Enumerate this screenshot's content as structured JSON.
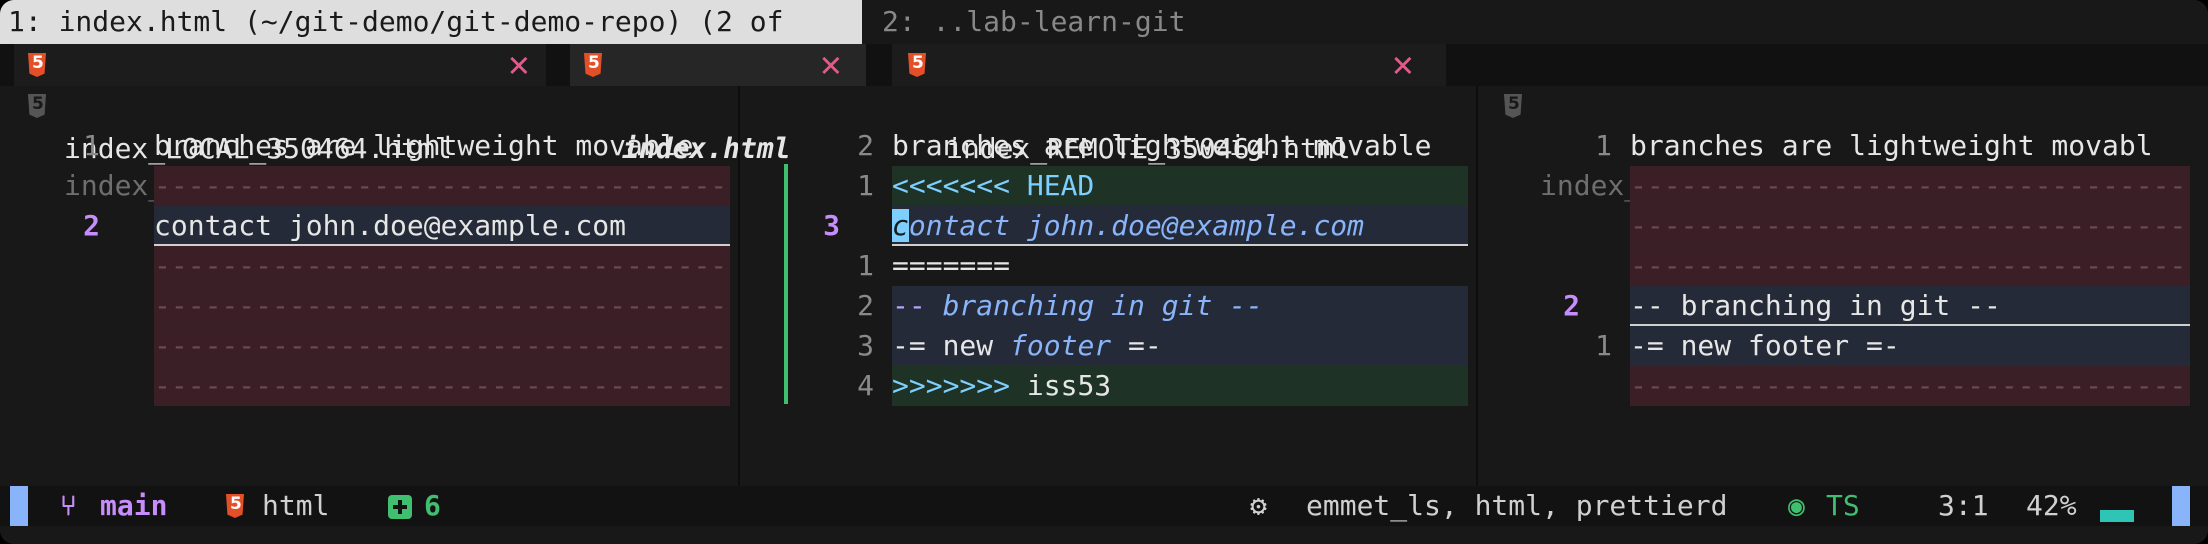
{
  "tmux": {
    "window1": "1: index.html (~/git-demo/git-demo-repo) (2 of",
    "window2": "2: ..lab-learn-git"
  },
  "tabs": [
    {
      "label": "index_LOCAL_350464.html",
      "close": "✕",
      "active": false
    },
    {
      "label": "index.html",
      "close": "✕",
      "active": true
    },
    {
      "label": "index_REMOTE_350464.html",
      "close": "✕",
      "active": false
    }
  ],
  "panes": {
    "local": {
      "winbar": "index_LOCAL_350464.html",
      "lines": [
        {
          "num": "1",
          "text": "branches are lightweight movable"
        },
        {
          "num": "",
          "text": "--------------------------------------"
        },
        {
          "num": "2",
          "text": "contact john.doe@example.com"
        },
        {
          "num": "",
          "text": "--------------------------------------"
        },
        {
          "num": "",
          "text": "--------------------------------------"
        },
        {
          "num": "",
          "text": "--------------------------------------"
        },
        {
          "num": "",
          "text": "--------------------------------------"
        }
      ]
    },
    "merged": {
      "lines": [
        {
          "num": "2",
          "text": "branches are lightweight movable"
        },
        {
          "num": "1",
          "text": "<<<<<<< HEAD"
        },
        {
          "num": "3",
          "cursor_char": "c",
          "text": "ontact john.doe@example.com"
        },
        {
          "num": "1",
          "text": "======="
        },
        {
          "num": "2",
          "prefix": "-- ",
          "text": "branching in git --"
        },
        {
          "num": "3",
          "prefix": "-= new ",
          "text": "footer",
          "suffix": " =-"
        },
        {
          "num": "4",
          "prefix": ">>>>>>>",
          "text": " iss53"
        }
      ]
    },
    "remote": {
      "winbar": "index_REMOTE_350464.html",
      "lines": [
        {
          "num": "1",
          "text": "branches are lightweight movabl"
        },
        {
          "num": "",
          "text": "--------------------------------------"
        },
        {
          "num": "",
          "text": "--------------------------------------"
        },
        {
          "num": "",
          "text": "--------------------------------------"
        },
        {
          "num": "2",
          "text": "-- branching in git --"
        },
        {
          "num": "1",
          "text": "-= new footer =-"
        },
        {
          "num": "",
          "text": "--------------------------------------"
        }
      ]
    }
  },
  "statusline": {
    "branch": "main",
    "filetype": "html",
    "added": "6",
    "lsp": "emmet_ls, html, prettierd",
    "treesitter": "TS",
    "position": "3:1",
    "percent": "42%"
  },
  "colors": {
    "accent": "#89b4fa",
    "added": "#3fbf6f",
    "branch": "#c68dfb",
    "close": "#e05a8c",
    "html_icon": "#e34f26"
  },
  "icons": {
    "branch": "git-branch-icon",
    "filetype": "html5-icon",
    "added": "plus-square-icon",
    "lsp": "gears-icon",
    "treesitter": "treesitter-icon"
  }
}
